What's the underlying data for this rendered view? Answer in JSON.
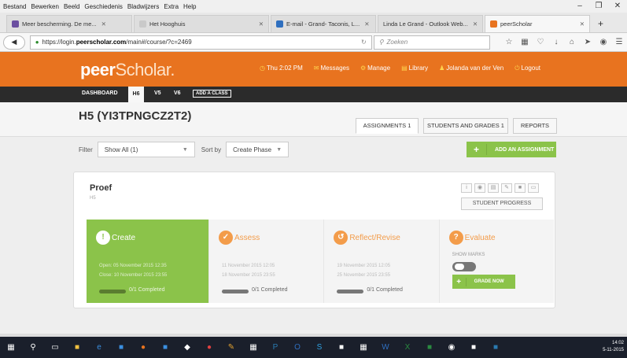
{
  "menubar": {
    "items": [
      "Bestand",
      "Bewerken",
      "Beeld",
      "Geschiedenis",
      "Bladwijzers",
      "Extra",
      "Help"
    ]
  },
  "tabs": [
    {
      "label": "Meer bescherming. De me...",
      "color": "#6b4fa0"
    },
    {
      "label": "Het Hooghuis",
      "color": "#c9c9c9"
    },
    {
      "label": "E-mail - Grand- Taconis, L...",
      "color": "#2f6fbf"
    },
    {
      "label": "Linda Le Grand - Outlook Web...",
      "color": "#2f6fbf"
    },
    {
      "label": "peerScholar",
      "color": "#e8731f"
    }
  ],
  "urlbar": {
    "prefix": "https://login.",
    "host": "peerscholar.com",
    "path": "/main#/course/?c=2469",
    "search_placeholder": "Zoeken"
  },
  "header": {
    "logo_a": "peer",
    "logo_b": "Scholar.",
    "time": "Thu 2:02 PM",
    "messages": "Messages",
    "manage": "Manage",
    "library": "Library",
    "user": "Jolanda van der Ven",
    "logout": "Logout"
  },
  "subnav": {
    "dashboard": "DASHBOARD",
    "h6": "H6",
    "v5": "V5",
    "v6": "V6",
    "add_class": "ADD A CLASS"
  },
  "page": {
    "title": "H5 (YI3TPNGCZ2T2)"
  },
  "tabs_main": {
    "assignments": "ASSIGNMENTS 1",
    "students": "STUDENTS AND GRADES 1",
    "reports": "REPORTS"
  },
  "filter": {
    "label": "Filter",
    "value": "Show All (1)",
    "sort_label": "Sort by",
    "sort_value": "Create Phase",
    "add": "ADD AN ASSIGNMENT"
  },
  "card": {
    "title": "Proef",
    "subtitle": "H5",
    "progress": "STUDENT PROGRESS",
    "create": {
      "name": "Create",
      "d1": "Open: 05 November 2015  12:35",
      "d2": "Close: 10 November 2015  23:55",
      "completed": "0/1 Completed"
    },
    "assess": {
      "name": "Assess",
      "d1": "11 November 2015  12:05",
      "d2": "18 November 2015  23:55",
      "completed": "0/1 Completed"
    },
    "reflect": {
      "name": "Reflect/Revise",
      "d1": "19 November 2015  12:05",
      "d2": "25 November 2015  23:55",
      "completed": "0/1 Completed"
    },
    "evaluate": {
      "name": "Evaluate",
      "show_marks": "SHOW MARKS",
      "grade_now": "GRADE NOW"
    }
  },
  "tray": {
    "time": "14:02",
    "date": "5-11-2015"
  }
}
